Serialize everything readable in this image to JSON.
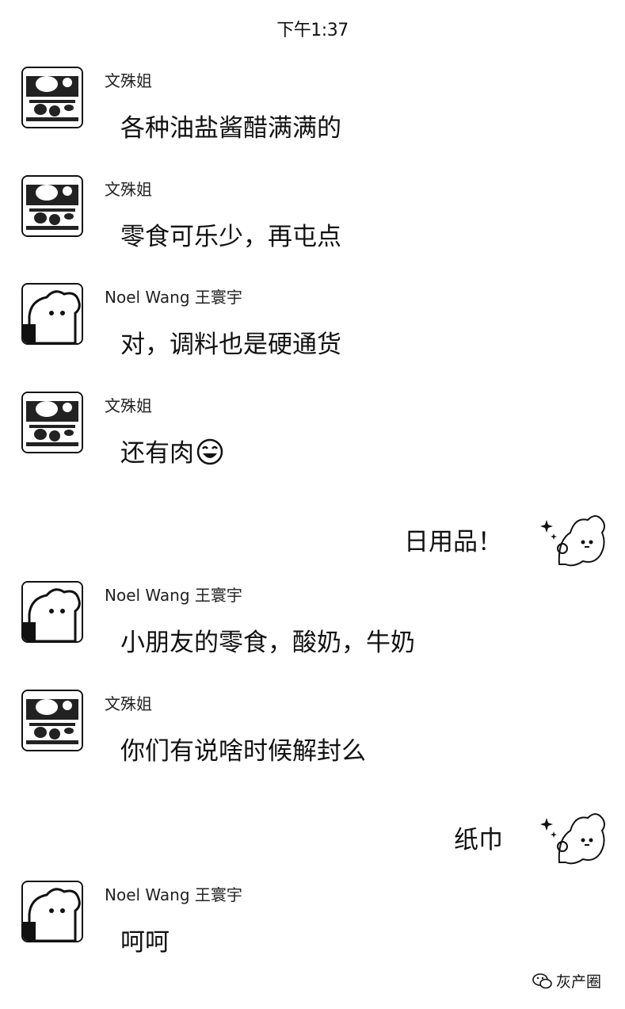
{
  "status": {
    "time": "下午1:37"
  },
  "messages": [
    {
      "sender": "文殊姐",
      "text": "各种油盐酱醋满满的",
      "avatar": "panda-icon"
    },
    {
      "sender": "文殊姐",
      "text": "零食可乐少，再屯点",
      "avatar": "panda-icon"
    },
    {
      "sender": "Noel Wang 王寰宇",
      "text": "对，调料也是硬通货",
      "avatar": "bear-icon"
    },
    {
      "sender": "文殊姐",
      "text": "还有肉",
      "avatar": "panda-icon",
      "emoji": "laughing-emoji-icon"
    },
    {
      "mine": true,
      "text": "日用品！",
      "avatar": "sparkle-ghost-icon"
    },
    {
      "sender": "Noel Wang 王寰宇",
      "text": "小朋友的零食，酸奶，牛奶",
      "avatar": "bear-icon"
    },
    {
      "sender": "文殊姐",
      "text": "你们有说啥时候解封么",
      "avatar": "panda-icon"
    },
    {
      "mine": true,
      "text": "纸巾",
      "avatar": "sparkle-ghost-icon"
    },
    {
      "sender": "Noel Wang 王寰宇",
      "text": "呵呵",
      "avatar": "bear-icon"
    }
  ],
  "watermark": {
    "text": "灰产圈",
    "icon": "wechat-icon"
  }
}
